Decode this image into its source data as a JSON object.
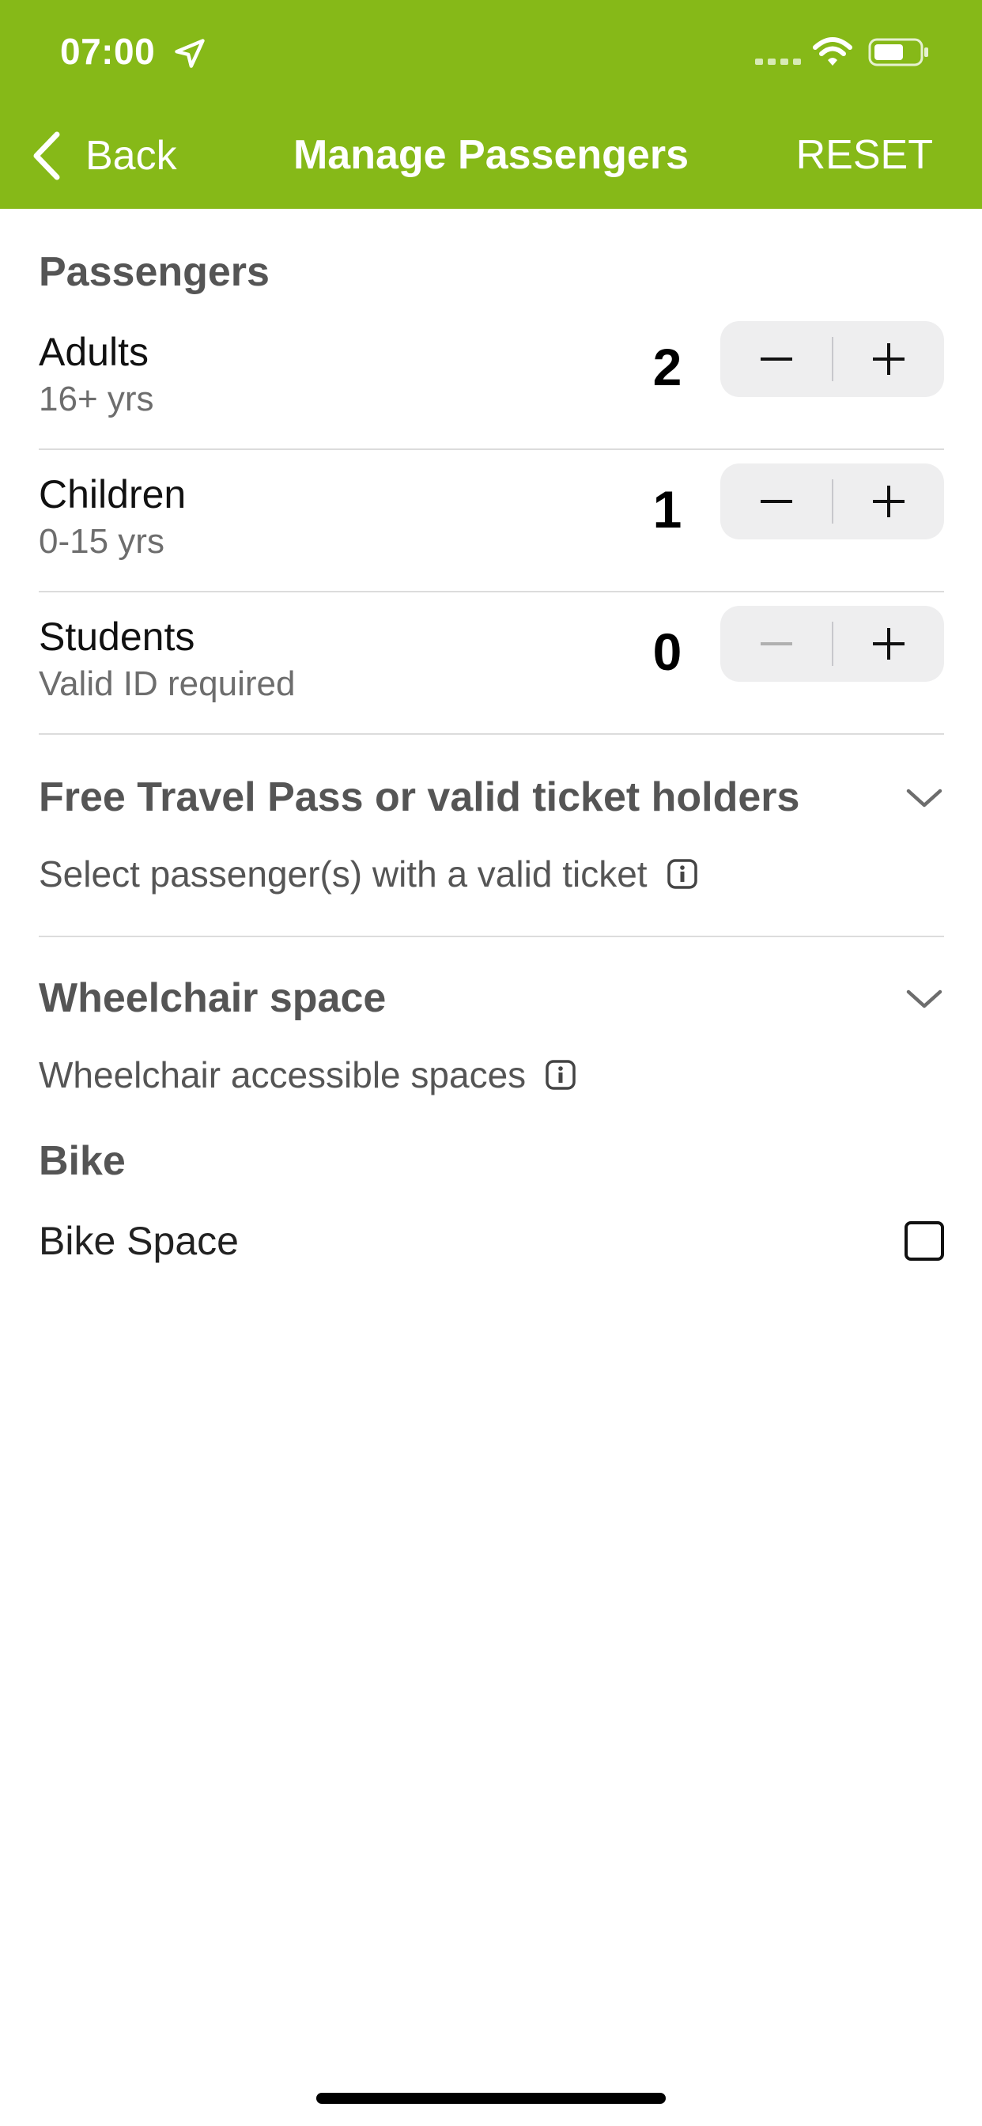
{
  "status_bar": {
    "time": "07:00"
  },
  "nav": {
    "back_label": "Back",
    "title": "Manage Passengers",
    "reset_label": "RESET"
  },
  "passengers": {
    "section_title": "Passengers",
    "rows": [
      {
        "name": "Adults",
        "subtitle": "16+ yrs",
        "count": "2",
        "minus_enabled": true
      },
      {
        "name": "Children",
        "subtitle": "0-15 yrs",
        "count": "1",
        "minus_enabled": true
      },
      {
        "name": "Students",
        "subtitle": "Valid ID required",
        "count": "0",
        "minus_enabled": false
      }
    ]
  },
  "free_travel": {
    "title": "Free Travel Pass or valid ticket holders",
    "subtitle": "Select passenger(s) with a valid ticket"
  },
  "wheelchair": {
    "title": "Wheelchair space",
    "subtitle": "Wheelchair accessible spaces"
  },
  "bike": {
    "title": "Bike",
    "option_label": "Bike Space",
    "checked": false
  },
  "colors": {
    "header_green": "#86b918",
    "stepper_bg": "#eeeeef",
    "disabled_gray": "#b0b0b0"
  }
}
